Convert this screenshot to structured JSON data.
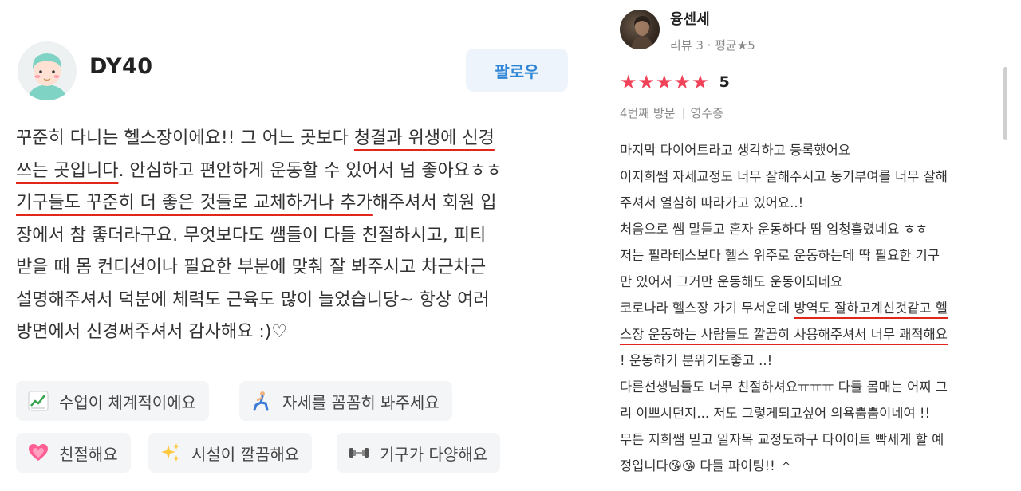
{
  "left_review": {
    "username": "DY40",
    "follow_label": "팔로우",
    "text_lines": [
      {
        "before": "꾸준히 다니는 헬스장이에요!! 그 어느 곳보다 ",
        "ul": "청결과 위생에 신경",
        "after": ""
      },
      {
        "before": "",
        "ul": "쓰는 곳입니다",
        "after": ". 안심하고 편안하게 운동할 수 있어서 넘 좋아요ㅎㅎ"
      },
      {
        "before": "",
        "ul": "기구들도 꾸준히 더 좋은 것들로 교체하거나 추가",
        "after": "해주셔서 회원 입"
      },
      {
        "before": "장에서 참 좋더라구요. 무엇보다도 쌤들이 다들 친절하시고, 피티",
        "ul": "",
        "after": ""
      },
      {
        "before": "받을 때 몸 컨디션이나 필요한 부분에 맞춰 잘 봐주시고 차근차근",
        "ul": "",
        "after": ""
      },
      {
        "before": "설명해주셔서 덕분에 체력도 근육도 많이 늘었습니당~ 항상 여러",
        "ul": "",
        "after": ""
      },
      {
        "before": "방면에서 신경써주셔서 감사해요 :)♡",
        "ul": "",
        "after": ""
      }
    ],
    "keywords": [
      {
        "emoji": "📈",
        "label": "수업이 체계적이에요",
        "icon": "chart-up-icon"
      },
      {
        "emoji": "🧎",
        "label": "자세를 꼼꼼히 봐주세요",
        "icon": "kneeling-person-icon"
      },
      {
        "emoji": "💗",
        "label": "친절해요",
        "icon": "heart-icon"
      },
      {
        "emoji": "✨",
        "label": "시설이 깔끔해요",
        "icon": "sparkles-icon"
      },
      {
        "emoji": "",
        "label": "기구가 다양해요",
        "icon": "dumbbell-icon"
      }
    ]
  },
  "right_review": {
    "username": "융센세",
    "meta": "리뷰 3 · 평균★5",
    "stars": 5,
    "score": "5",
    "visit": "4번째 방문",
    "receipt": "영수증",
    "text_lines": [
      {
        "before": "마지막 다이어트라고 생각하고 등록했어요",
        "ul": "",
        "after": ""
      },
      {
        "before": "이지희쌤 자세교정도 너무 잘해주시고 동기부여를 너무 잘해",
        "ul": "",
        "after": ""
      },
      {
        "before": "주셔서 열심히 따라가고 있어요..!",
        "ul": "",
        "after": ""
      },
      {
        "before": "처음으로 쌤 말듣고 혼자 운동하다 땀 엄청흘렸네요 ㅎㅎ",
        "ul": "",
        "after": ""
      },
      {
        "before": "저는 필라테스보다 헬스 위주로 운동하는데 딱 필요한 기구",
        "ul": "",
        "after": ""
      },
      {
        "before": "만 있어서 그거만 운동해도 운동이되네요",
        "ul": "",
        "after": ""
      },
      {
        "before": "코로나라 헬스장 가기 무서운데 ",
        "ul": "방역도 잘하고계신것같고 헬",
        "after": ""
      },
      {
        "before": "",
        "ul": "스장 운동하는 사람들도 깔끔히 사용해주셔서 너무 쾌적해요",
        "after": ""
      },
      {
        "before": "! 운동하기 분위기도좋고 ..!",
        "ul": "",
        "after": ""
      },
      {
        "before": "다른선생님들도 너무 친절하셔요ㅠㅠㅠ 다들 몸매는 어찌 그",
        "ul": "",
        "after": ""
      },
      {
        "before": "리 이쁘시던지... 저도 그렇게되고싶어 의욕뿜뿜이네여 !!",
        "ul": "",
        "after": ""
      },
      {
        "before": "무튼 지희쌤 믿고 일자목 교정도하구 다이어트 빡세게 할 예",
        "ul": "",
        "after": ""
      },
      {
        "before": "정입니다😘😘 다들 파이팅!!",
        "ul": "",
        "after": ""
      }
    ],
    "collapse_glyph": "^"
  }
}
